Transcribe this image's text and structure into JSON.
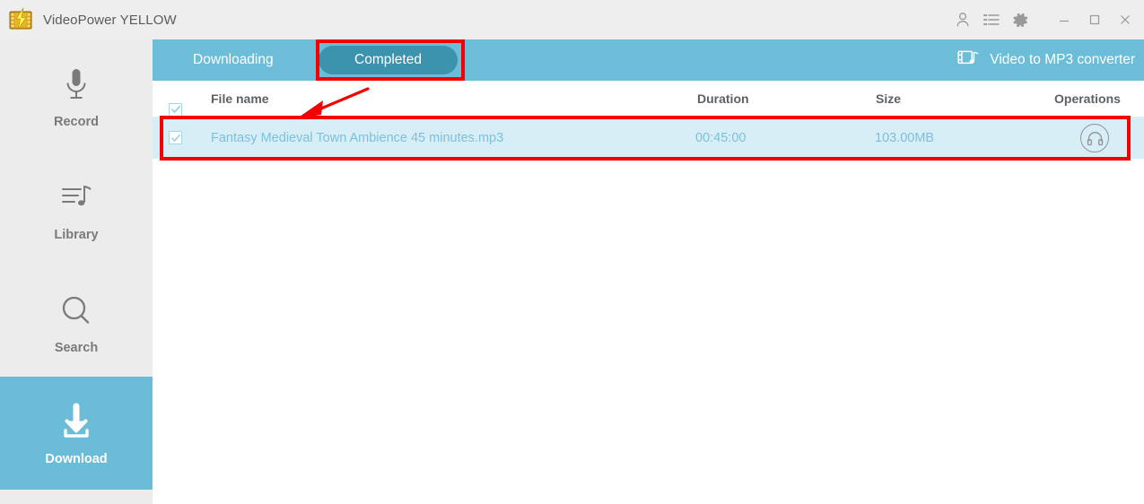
{
  "window": {
    "title": "VideoPower YELLOW",
    "logo_icon": "lightning-film-logo",
    "actions": [
      {
        "name": "account-icon",
        "glyph": "user"
      },
      {
        "name": "task-list-icon",
        "glyph": "list"
      },
      {
        "name": "settings-icon",
        "glyph": "gear"
      }
    ],
    "controls": [
      {
        "name": "minimize-button",
        "glyph": "minimize"
      },
      {
        "name": "maximize-button",
        "glyph": "maximize"
      },
      {
        "name": "close-button",
        "glyph": "close"
      }
    ]
  },
  "sidebar": {
    "items": [
      {
        "label": "Record",
        "icon": "microphone-icon",
        "active": false
      },
      {
        "label": "Library",
        "icon": "playlist-music-icon",
        "active": false
      },
      {
        "label": "Search",
        "icon": "magnifier-icon",
        "active": false
      },
      {
        "label": "Download",
        "icon": "download-arrow-icon",
        "active": true
      }
    ],
    "active_color": "#6bbcd6"
  },
  "main": {
    "tabs": [
      {
        "label": "Downloading",
        "selected": false
      },
      {
        "label": "Completed",
        "selected": true
      }
    ],
    "converter": {
      "label": "Video to MP3 converter",
      "icon": "video-to-mp3-icon"
    },
    "table": {
      "columns": [
        "File name",
        "Duration",
        "Size",
        "Operations"
      ],
      "select_all_checked": true,
      "rows": [
        {
          "checked": true,
          "file_name": "Fantasy Medieval Town Ambience  45 minutes.mp3",
          "duration": "00:45:00",
          "size": "103.00MB",
          "operation_icon": "headphones-icon"
        }
      ]
    }
  },
  "annotations": {
    "color": "#f50000",
    "shapes": [
      {
        "name": "completed-tab-highlight",
        "type": "rectangle"
      },
      {
        "name": "completed-row-highlight",
        "type": "rectangle"
      },
      {
        "name": "pointer-arrow",
        "type": "arrow"
      }
    ]
  },
  "colors": {
    "titlebar": "#eeeeee",
    "sidebar": "#ececec",
    "tabbar": "#6cbdd7",
    "tab_selected": "#3b93ad",
    "row_highlight": "#d8eef7",
    "row_text": "#7cc0dc"
  }
}
